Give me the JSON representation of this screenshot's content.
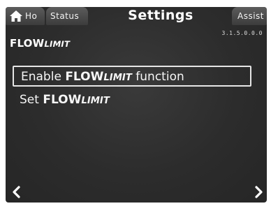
{
  "tabs": {
    "home_label": "Ho",
    "status_label": "Status",
    "active_label": "Settings",
    "assist_label": "Assist"
  },
  "version": "3.1.5.0.0.0",
  "page_title": {
    "prefix": "FLOW",
    "suffix": "LIMIT"
  },
  "menu": {
    "items": [
      {
        "pre": "Enable ",
        "flow": "FLOW",
        "limit": "LIMIT",
        "post": " function",
        "selected": true
      },
      {
        "pre": "Set ",
        "flow": "FLOW",
        "limit": "LIMIT",
        "post": "",
        "selected": false
      }
    ]
  },
  "icons": {
    "home": "home-icon",
    "back": "chevron-left-icon",
    "forward": "chevron-right-icon"
  },
  "colors": {
    "background": "#2c2c2c",
    "tab": "#4a4a4a",
    "text": "#f2f2f2",
    "selection_border": "#e6e6e6"
  }
}
